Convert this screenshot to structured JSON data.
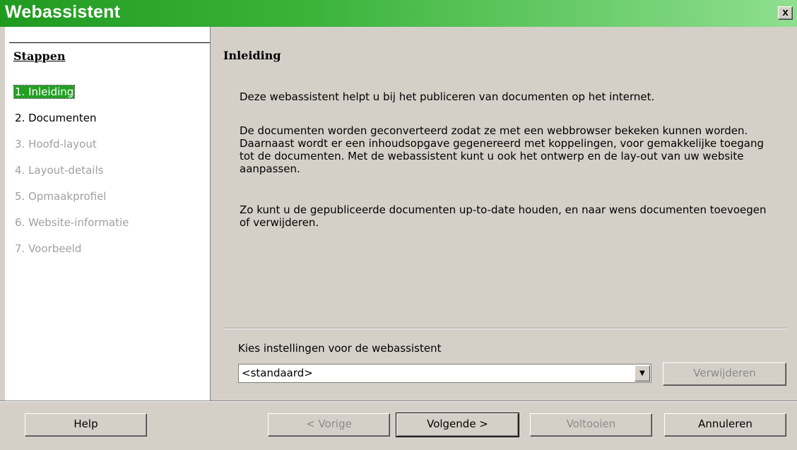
{
  "window": {
    "title": "Webassistent",
    "close_label": "x"
  },
  "sidebar": {
    "title": "Stappen",
    "steps": [
      {
        "label": "1. Inleiding",
        "state": "active"
      },
      {
        "label": "2. Documenten",
        "state": "enabled"
      },
      {
        "label": "3. Hoofd-layout",
        "state": "disabled"
      },
      {
        "label": "4. Layout-details",
        "state": "disabled"
      },
      {
        "label": "5. Opmaakprofiel",
        "state": "disabled"
      },
      {
        "label": "6. Website-informatie",
        "state": "disabled"
      },
      {
        "label": "7. Voorbeeld",
        "state": "disabled"
      }
    ]
  },
  "content": {
    "title": "Inleiding",
    "paragraph1": "Deze webassistent helpt u bij het publiceren van documenten op het internet.",
    "paragraph2": "De documenten worden geconverteerd zodat ze met een webbrowser bekeken kunnen worden. Daarnaast wordt er een inhoudsopgave gegenereerd met koppelingen, voor gemakkelijke toegang tot de documenten. Met de webassistent kunt u ook het ontwerp en de lay-out van uw website aanpassen.",
    "paragraph3": "Zo kunt u de gepubliceerde documenten up-to-date houden, en naar wens documenten toevoegen of verwijderen."
  },
  "settings": {
    "label": "Kies instellingen voor de webassistent",
    "selected": "<standaard>",
    "delete_label": "Verwijderen"
  },
  "buttons": {
    "help": "Help",
    "previous": "< Vorige",
    "next": "Volgende >",
    "finish": "Voltooien",
    "cancel": "Annuleren"
  },
  "colors": {
    "titlebar": "#2a9f2a",
    "active_step": "#22a022"
  }
}
